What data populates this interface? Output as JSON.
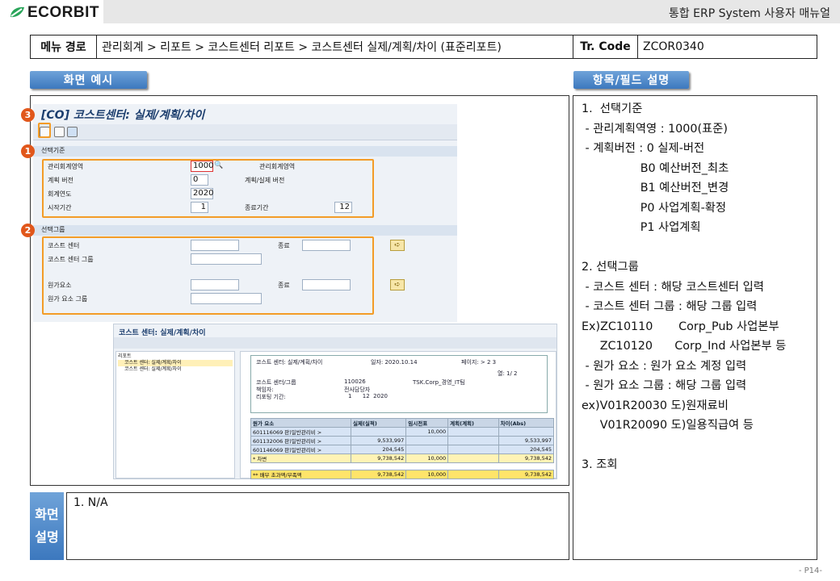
{
  "header": {
    "logo_text": "ECORBIT",
    "doc_title": "통합 ERP System 사용자 매뉴얼"
  },
  "menu": {
    "label": "메뉴 경로",
    "path": "관리회계 > 리포트 > 코스트센터 리포트 > 코스트센터 실제/계획/차이 (표준리포트)",
    "tr_label": "Tr. Code",
    "tr_code": "ZCOR0340"
  },
  "tabs": {
    "screen_example": "화면 예시",
    "field_desc": "항목/필드 설명"
  },
  "screen1": {
    "title": "[CO] 코스트센터: 실제/계획/차이",
    "group1": "선택기준",
    "group2": "선택그룹",
    "badges": [
      "1",
      "2",
      "3"
    ],
    "fields": {
      "area_label": "관리회계영역",
      "area_value": "1000",
      "area_desc": "관리회계영역",
      "version_label": "계획 버전",
      "version_value": "0",
      "version_desc": "계획/실제 버전",
      "year_label": "회계연도",
      "year_value": "2020",
      "from_label": "시작기간",
      "from_value": "1",
      "to_label": "종료기간",
      "to_value": "12",
      "cc_label": "코스트 센터",
      "cc_to": "종료",
      "ccg_label": "코스트 센터 그룹",
      "ce_label": "원가요소",
      "ce_to": "종료",
      "ceg_label": "원가 요소 그룹"
    }
  },
  "screen2": {
    "title": "코스트 센터: 실제/계획/차이",
    "tree_root": "리포트",
    "tree_items": [
      "코스트 센터: 실제/계획/차이",
      "코스트 센터: 실제/계획/차이"
    ],
    "rep_title": "코스트 센터: 실제/계획/차이",
    "rep_date": "일자: 2020.10.14",
    "rep_page": "페이지: > 2 3",
    "rep_col": "열: 1/ 2",
    "rep_cc_label": "코스트 센터/그룹",
    "rep_cc_value": "110026",
    "rep_cc_name": "TSK.Corp_경영_IT팀",
    "rep_resp_label": "책임자:",
    "rep_resp_value": "전사담당자",
    "rep_period_label": "리포팅 기간:",
    "rep_period_value": "1      12  2020",
    "table_headers": [
      "원가 요소",
      "실제(실적)",
      "임시전표",
      "계획(계획)",
      "차이(Abs)"
    ],
    "rows": [
      [
        "601116069  판)일반관리비 >",
        "",
        "10,000",
        "",
        ""
      ],
      [
        "601132006  판)일반관리비 >",
        "9,533,997",
        "",
        "",
        "9,533,997"
      ],
      [
        "601146069  판)일반관리비 >",
        "204,545",
        "",
        "",
        "204,545"
      ],
      [
        "* 차변",
        "9,738,542",
        "10,000",
        "",
        "9,738,542"
      ],
      [
        "** 배부 초과액/부족액",
        "9,738,542",
        "10,000",
        "",
        "9,738,542"
      ]
    ]
  },
  "field_lines": [
    "1.  선택기준",
    " - 관리계획역영 : 1000(표준)",
    " - 계획버전 : 0 실제-버전",
    "                B0 예산버전_최초",
    "                B1 예산버전_변경",
    "                P0 사업계획-확정",
    "                P1 사업계획",
    "",
    "2. 선택그룹",
    " - 코스트 센터 : 해당 코스트센터 입력",
    " - 코스트 센터 그룹 : 해당 그룹 입력",
    "Ex)ZC10110       Corp_Pub 사업본부",
    "     ZC10120      Corp_Ind 사업본부 등",
    " - 원가 요소 : 원가 요소 계정 입력",
    " - 원가 요소 그룹 : 해당 그룹 입력",
    "ex)V01R20030 도)원재료비",
    "     V01R20090 도)일용직급여 등",
    "",
    "3. 조회"
  ],
  "desc": {
    "label_1": "화면",
    "label_2": "설명",
    "text": "1.   N/A"
  },
  "page": "- P14-"
}
